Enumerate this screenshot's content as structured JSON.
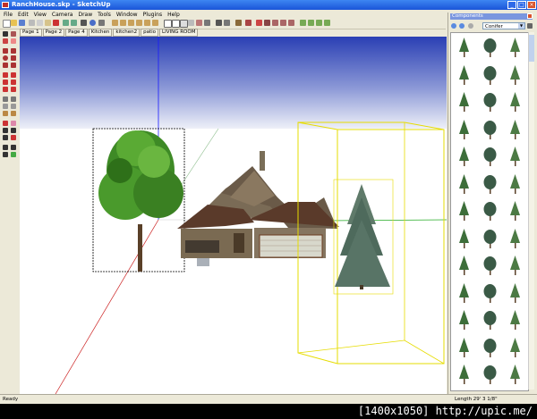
{
  "window": {
    "title": "RanchHouse.skp - SketchUp"
  },
  "menu": [
    "File",
    "Edit",
    "View",
    "Camera",
    "Draw",
    "Tools",
    "Window",
    "Plugins",
    "Help"
  ],
  "scene_tabs": [
    "Page 1",
    "Page 2",
    "Page 4",
    "Kitchen",
    "kitchen2",
    "patio",
    "LIVING ROOM"
  ],
  "components": {
    "title": "Components",
    "collection": "Conifer"
  },
  "status": {
    "message": "Ready",
    "measurement": "Length 29' 3 1/8\""
  },
  "caption": "[1400x1050] http://upic.me/",
  "colors": {
    "sky_top": "#2a3fb4",
    "sky_bottom": "#eef0f8",
    "ground": "#ffffff",
    "axis_blue": "#1a1aff",
    "axis_green": "#22aa22",
    "axis_red": "#cc2222",
    "selection": "#ffee00"
  }
}
